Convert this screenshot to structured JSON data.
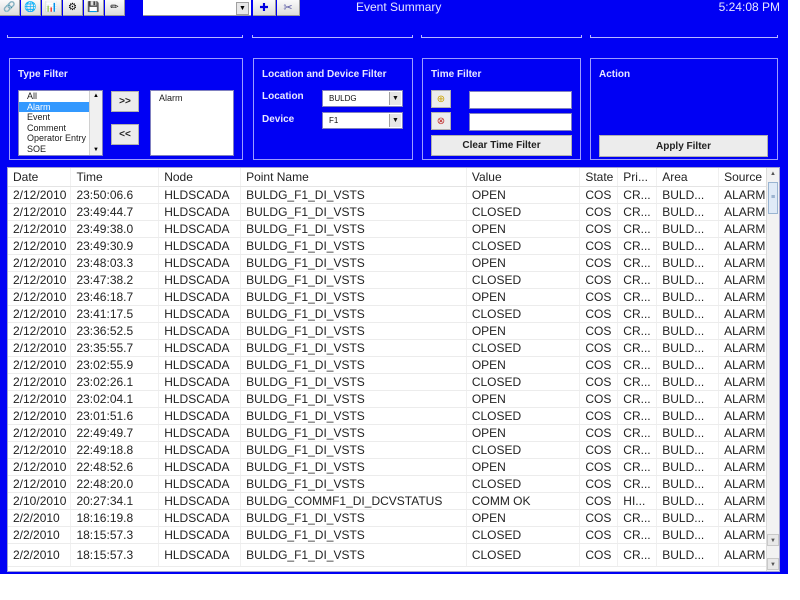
{
  "window": {
    "title": "Event Summary",
    "clock": "5:24:08 PM"
  },
  "toolbar": {
    "buttons": [
      {
        "name": "link-icon",
        "glyph": "🔗"
      },
      {
        "name": "globe-icon",
        "glyph": "🌐"
      },
      {
        "name": "bar-chart-icon",
        "glyph": "📊"
      },
      {
        "name": "gear-icon",
        "glyph": "⚙"
      },
      {
        "name": "save-icon",
        "glyph": "💾"
      },
      {
        "name": "pencil-icon",
        "glyph": "✏"
      }
    ],
    "combo_value": "",
    "pin_glyph": "✚",
    "tool_glyph": "✂"
  },
  "type_filter": {
    "title": "Type Filter",
    "available": [
      "All",
      "Alarm",
      "Event",
      "Comment",
      "Operator Entry",
      "SOE"
    ],
    "selected_available": "Alarm",
    "add_label": ">>",
    "remove_label": "<<",
    "chosen": [
      "Alarm"
    ]
  },
  "location_filter": {
    "title": "Location and Device Filter",
    "location_label": "Location",
    "location_value": "BULDG",
    "device_label": "Device",
    "device_value": "F1"
  },
  "time_filter": {
    "title": "Time Filter",
    "start_value": "",
    "end_value": "",
    "clear_label": "Clear Time Filter"
  },
  "action": {
    "title": "Action",
    "apply_label": "Apply Filter"
  },
  "grid": {
    "columns": [
      "Date",
      "Time",
      "Node",
      "Point Name",
      "Value",
      "State",
      "Pri...",
      "Area",
      "Source"
    ],
    "rows": [
      [
        "2/12/2010",
        "23:50:06.6",
        "HLDSCADA",
        "BULDG_F1_DI_VSTS",
        "OPEN",
        "COS",
        "CR...",
        "BULD...",
        "ALARM"
      ],
      [
        "2/12/2010",
        "23:49:44.7",
        "HLDSCADA",
        "BULDG_F1_DI_VSTS",
        "CLOSED",
        "COS",
        "CR...",
        "BULD...",
        "ALARM"
      ],
      [
        "2/12/2010",
        "23:49:38.0",
        "HLDSCADA",
        "BULDG_F1_DI_VSTS",
        "OPEN",
        "COS",
        "CR...",
        "BULD...",
        "ALARM"
      ],
      [
        "2/12/2010",
        "23:49:30.9",
        "HLDSCADA",
        "BULDG_F1_DI_VSTS",
        "CLOSED",
        "COS",
        "CR...",
        "BULD...",
        "ALARM"
      ],
      [
        "2/12/2010",
        "23:48:03.3",
        "HLDSCADA",
        "BULDG_F1_DI_VSTS",
        "OPEN",
        "COS",
        "CR...",
        "BULD...",
        "ALARM"
      ],
      [
        "2/12/2010",
        "23:47:38.2",
        "HLDSCADA",
        "BULDG_F1_DI_VSTS",
        "CLOSED",
        "COS",
        "CR...",
        "BULD...",
        "ALARM"
      ],
      [
        "2/12/2010",
        "23:46:18.7",
        "HLDSCADA",
        "BULDG_F1_DI_VSTS",
        "OPEN",
        "COS",
        "CR...",
        "BULD...",
        "ALARM"
      ],
      [
        "2/12/2010",
        "23:41:17.5",
        "HLDSCADA",
        "BULDG_F1_DI_VSTS",
        "CLOSED",
        "COS",
        "CR...",
        "BULD...",
        "ALARM"
      ],
      [
        "2/12/2010",
        "23:36:52.5",
        "HLDSCADA",
        "BULDG_F1_DI_VSTS",
        "OPEN",
        "COS",
        "CR...",
        "BULD...",
        "ALARM"
      ],
      [
        "2/12/2010",
        "23:35:55.7",
        "HLDSCADA",
        "BULDG_F1_DI_VSTS",
        "CLOSED",
        "COS",
        "CR...",
        "BULD...",
        "ALARM"
      ],
      [
        "2/12/2010",
        "23:02:55.9",
        "HLDSCADA",
        "BULDG_F1_DI_VSTS",
        "OPEN",
        "COS",
        "CR...",
        "BULD...",
        "ALARM"
      ],
      [
        "2/12/2010",
        "23:02:26.1",
        "HLDSCADA",
        "BULDG_F1_DI_VSTS",
        "CLOSED",
        "COS",
        "CR...",
        "BULD...",
        "ALARM"
      ],
      [
        "2/12/2010",
        "23:02:04.1",
        "HLDSCADA",
        "BULDG_F1_DI_VSTS",
        "OPEN",
        "COS",
        "CR...",
        "BULD...",
        "ALARM"
      ],
      [
        "2/12/2010",
        "23:01:51.6",
        "HLDSCADA",
        "BULDG_F1_DI_VSTS",
        "CLOSED",
        "COS",
        "CR...",
        "BULD...",
        "ALARM"
      ],
      [
        "2/12/2010",
        "22:49:49.7",
        "HLDSCADA",
        "BULDG_F1_DI_VSTS",
        "OPEN",
        "COS",
        "CR...",
        "BULD...",
        "ALARM"
      ],
      [
        "2/12/2010",
        "22:49:18.8",
        "HLDSCADA",
        "BULDG_F1_DI_VSTS",
        "CLOSED",
        "COS",
        "CR...",
        "BULD...",
        "ALARM"
      ],
      [
        "2/12/2010",
        "22:48:52.6",
        "HLDSCADA",
        "BULDG_F1_DI_VSTS",
        "OPEN",
        "COS",
        "CR...",
        "BULD...",
        "ALARM"
      ],
      [
        "2/12/2010",
        "22:48:20.0",
        "HLDSCADA",
        "BULDG_F1_DI_VSTS",
        "CLOSED",
        "COS",
        "CR...",
        "BULD...",
        "ALARM"
      ],
      [
        "2/10/2010",
        "20:27:34.1",
        "HLDSCADA",
        "BULDG_COMMF1_DI_DCVSTATUS",
        "COMM OK",
        "COS",
        "HI...",
        "BULD...",
        "ALARM"
      ],
      [
        "2/2/2010",
        "18:16:19.8",
        "HLDSCADA",
        "BULDG_F1_DI_VSTS",
        "OPEN",
        "COS",
        "CR...",
        "BULD...",
        "ALARM"
      ],
      [
        "2/2/2010",
        "18:15:57.3",
        "HLDSCADA",
        "BULDG_F1_DI_VSTS",
        "CLOSED",
        "COS",
        "CR...",
        "BULD...",
        "ALARM"
      ],
      [
        "2/2/2010",
        "18:15:57.3",
        "HLDSCADA",
        "BULDG_F1_DI_VSTS",
        "CLOSED",
        "COS",
        "CR...",
        "BULD...",
        "ALARM"
      ]
    ]
  },
  "colors": {
    "background": "#0000f4",
    "panel_border": "#9c9cff",
    "selection": "#3399ff"
  }
}
